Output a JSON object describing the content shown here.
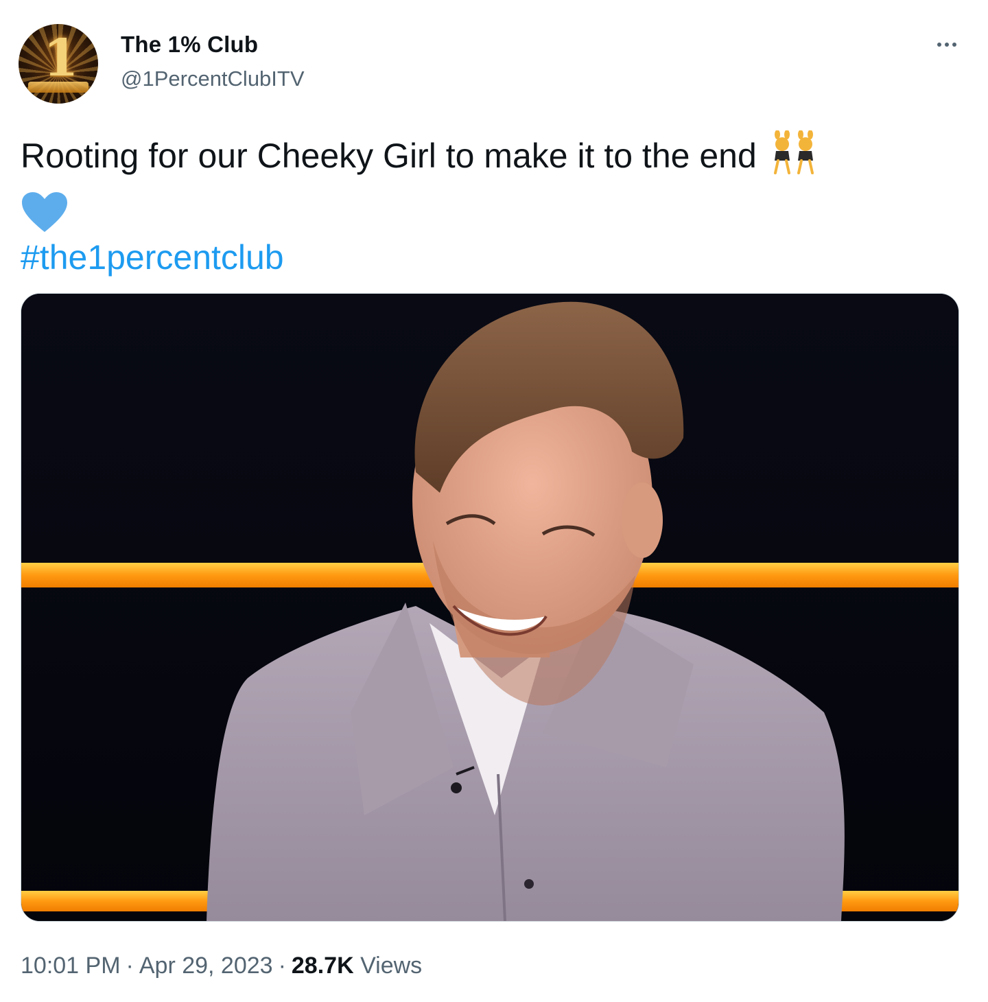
{
  "author": {
    "display_name": "The 1% Club",
    "handle": "@1PercentClubITV"
  },
  "tweet": {
    "text": "Rooting for our Cheeky Girl to make it to the end",
    "emoji_1": "people-with-bunny-ears",
    "emoji_2": "blue-heart",
    "hashtag": "#the1percentclub"
  },
  "meta": {
    "time": "10:01 PM",
    "date": "Apr 29, 2023",
    "views_count": "28.7K",
    "views_label": "Views",
    "separator": "·"
  },
  "colors": {
    "link": "#1d9bf0",
    "secondary_text": "#536471",
    "primary_text": "#0f1419",
    "heart": "#5dadec",
    "stage_light": "#ff9f1a"
  },
  "icons": {
    "more": "more-horizontal-icon"
  }
}
